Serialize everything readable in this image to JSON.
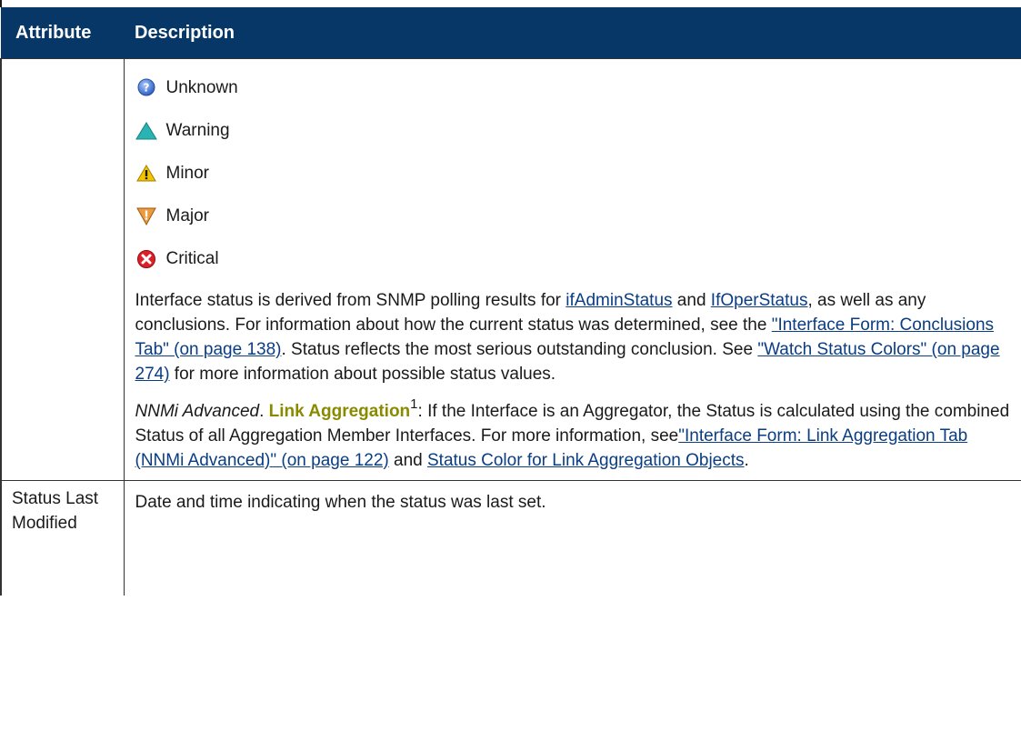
{
  "table": {
    "headers": {
      "attribute": "Attribute",
      "description": "Description"
    },
    "status_items": [
      {
        "icon": "unknown-status-icon",
        "label": "Unknown"
      },
      {
        "icon": "warning-status-icon",
        "label": "Warning"
      },
      {
        "icon": "minor-status-icon",
        "label": "Minor"
      },
      {
        "icon": "major-status-icon",
        "label": "Major"
      },
      {
        "icon": "critical-status-icon",
        "label": "Critical"
      }
    ],
    "para1": {
      "t1": "Interface status is derived from SNMP polling results for ",
      "link1": "ifAdminStatus",
      "t2": " and ",
      "link2": "IfOperStatus",
      "t3": ", as well as any conclusions. For information about how the current status was determined, see the ",
      "link3": "\"Interface Form: Conclusions Tab\" (on page 138)",
      "t4": ". Status reflects the most serious outstanding conclusion. See ",
      "link4": "\"Watch Status Colors\" (on page 274)",
      "t5": " for more information about possible status values."
    },
    "para2": {
      "em": "NNMi Advanced",
      "t1": ". ",
      "glossary": "Link Aggregation",
      "sup": "1",
      "t2": ": If the Interface is an Aggregator, the Status is calculated using the combined Status of all Aggregation Member Interfaces. For more information, see",
      "link1": "\"Interface Form: Link Aggregation Tab (NNMi Advanced)\" (on page 122)",
      "t3": " and ",
      "link2": "Status Color for Link Aggregation Objects",
      "t4": "."
    },
    "row2": {
      "attribute": "Status Last Modified",
      "description": "Date and time indicating when the status was last set."
    }
  },
  "colors": {
    "header_bg": "#073767",
    "link": "#0a3d82",
    "glossary": "#8a8a00",
    "unknown": "#3b6fd4",
    "warning": "#22a7a7",
    "minor": "#f2c200",
    "major": "#e8953a",
    "critical": "#d81f26"
  }
}
